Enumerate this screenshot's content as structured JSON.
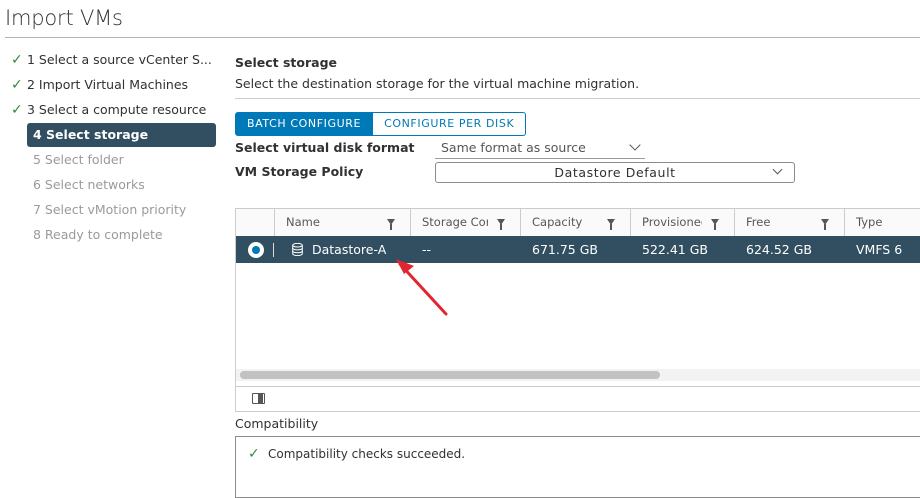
{
  "dialog": {
    "title": "Import VMs"
  },
  "steps": [
    {
      "label": "1 Select a source vCenter S...",
      "state": "done"
    },
    {
      "label": "2 Import Virtual Machines",
      "state": "done"
    },
    {
      "label": "3 Select a compute resource",
      "state": "done"
    },
    {
      "label": "4 Select storage",
      "state": "active"
    },
    {
      "label": "5 Select folder",
      "state": "todo"
    },
    {
      "label": "6 Select networks",
      "state": "todo"
    },
    {
      "label": "7 Select vMotion priority",
      "state": "todo"
    },
    {
      "label": "8 Ready to complete",
      "state": "todo"
    }
  ],
  "main": {
    "title": "Select storage",
    "description": "Select the destination storage for the virtual machine migration.",
    "mode_tabs": {
      "batch": "BATCH CONFIGURE",
      "per_disk": "CONFIGURE PER DISK"
    },
    "disk_format": {
      "label": "Select virtual disk format",
      "value": "Same format as source"
    },
    "storage_policy": {
      "label": "VM Storage Policy",
      "value": "Datastore Default"
    }
  },
  "grid": {
    "columns": [
      "Name",
      "Storage Con",
      "Capacity",
      "Provisioned",
      "Free",
      "Type"
    ],
    "rows": [
      {
        "name": "Datastore-A",
        "storage_compat": "--",
        "capacity": "671.75 GB",
        "provisioned": "522.41 GB",
        "free": "624.52 GB",
        "type": "VMFS 6"
      }
    ]
  },
  "compatibility": {
    "label": "Compatibility",
    "message": "Compatibility checks succeeded."
  },
  "colors": {
    "accent": "#0079b8",
    "selected_row": "#324f61",
    "success": "#2e8a3e",
    "annotation": "#e0262e"
  }
}
